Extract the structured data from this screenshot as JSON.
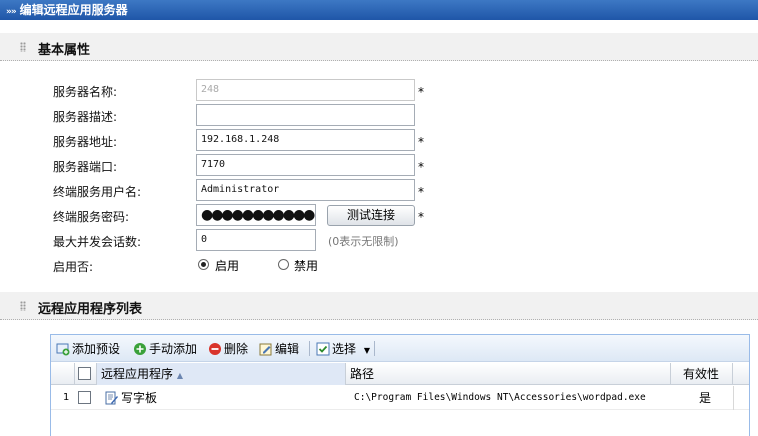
{
  "window": {
    "title": "编辑远程应用服务器",
    "title_arrows": "»»"
  },
  "section_basic": {
    "label": "基本属性"
  },
  "form": {
    "server_name": {
      "label": "服务器名称:",
      "value": "248",
      "required": "*"
    },
    "server_desc": {
      "label": "服务器描述:",
      "value": ""
    },
    "server_addr": {
      "label": "服务器地址:",
      "value": "192.168.1.248",
      "required": "*"
    },
    "server_port": {
      "label": "服务器端口:",
      "value": "7170",
      "required": "*"
    },
    "term_user": {
      "label": "终端服务用户名:",
      "value": "Administrator",
      "required": "*"
    },
    "term_pwd": {
      "label": "终端服务密码:",
      "value": "●●●●●●●●●●●",
      "required": "*"
    },
    "test_button": "测试连接",
    "max_sessions": {
      "label": "最大并发会话数:",
      "value": "0",
      "hint": "(0表示无限制)"
    },
    "enabled": {
      "label": "启用否:",
      "on_label": "启用",
      "off_label": "禁用",
      "selected": "启用"
    }
  },
  "section_apps": {
    "label": "远程应用程序列表"
  },
  "toolbar": {
    "add_preset": "添加预设",
    "manual_add": "手动添加",
    "delete": "删除",
    "edit": "编辑",
    "select": "选择"
  },
  "table": {
    "columns": {
      "name": "远程应用程序",
      "path": "路径",
      "valid": "有效性"
    },
    "sort_indicator": "▲",
    "rows": [
      {
        "index": "1",
        "name": "写字板",
        "path": "C:\\Program Files\\Windows NT\\Accessories\\wordpad.exe",
        "valid": "是"
      }
    ]
  },
  "colors": {
    "title_bg": "#2a62b4",
    "grid_border": "#99bbe8",
    "section_bg": "#f1f1f1"
  }
}
